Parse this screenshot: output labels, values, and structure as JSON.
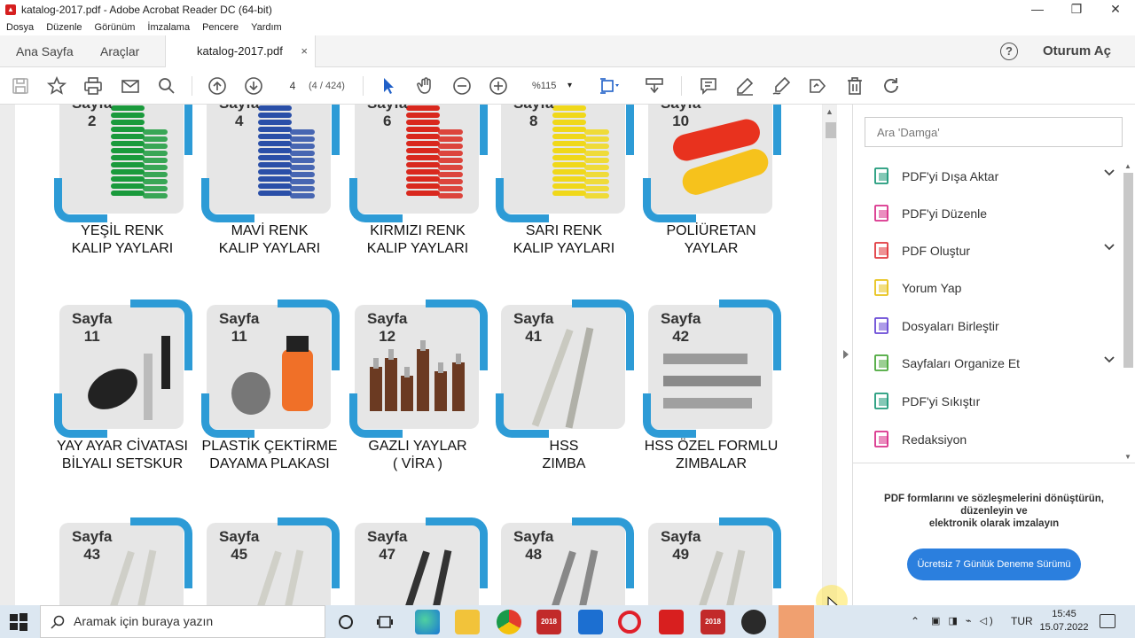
{
  "window": {
    "title": "katalog-2017.pdf - Adobe Acrobat Reader DC (64-bit)",
    "controls": {
      "minimize": "—",
      "maximize": "❐",
      "close": "✕"
    }
  },
  "menu": [
    "Dosya",
    "Düzenle",
    "Görünüm",
    "İmzalama",
    "Pencere",
    "Yardım"
  ],
  "tabs": {
    "home": "Ana Sayfa",
    "tools": "Araçlar",
    "document": "katalog-2017.pdf",
    "close": "×"
  },
  "help_label": "?",
  "signin": "Oturum Aç",
  "toolbar": {
    "page_current": "4",
    "page_count": "(4 / 424)",
    "zoom": "%115"
  },
  "catalog": {
    "row1": [
      {
        "page_label": "Sayfa",
        "page": "2",
        "line1": "YEŞİL RENK",
        "line2": "KALIP YAYLARI",
        "color": "#1a9a3c"
      },
      {
        "page_label": "Sayfa",
        "page": "4",
        "line1": "MAVİ RENK",
        "line2": "KALIP YAYLARI",
        "color": "#2a4fa8"
      },
      {
        "page_label": "Sayfa",
        "page": "6",
        "line1": "KIRMIZI RENK",
        "line2": "KALIP YAYLARI",
        "color": "#d9281e"
      },
      {
        "page_label": "Sayfa",
        "page": "8",
        "line1": "SARI RENK",
        "line2": "KALIP YAYLARI",
        "color": "#f0d81a"
      },
      {
        "page_label": "Sayfa",
        "page": "10",
        "line1": "POLİÜRETAN",
        "line2": "YAYLAR",
        "color": "#e8321e"
      }
    ],
    "row2": [
      {
        "page_label": "Sayfa",
        "page": "11",
        "line1": "YAY AYAR CİVATASI",
        "line2": "BİLYALI SETSKUR",
        "color": "#222222"
      },
      {
        "page_label": "Sayfa",
        "page": "11",
        "line1": "PLASTİK ÇEKTİRME",
        "line2": "DAYAMA PLAKASI",
        "color": "#f07028"
      },
      {
        "page_label": "Sayfa",
        "page": "12",
        "line1": "GAZLI YAYLAR",
        "line2": "( VİRA )",
        "color": "#6b3a22"
      },
      {
        "page_label": "Sayfa",
        "page": "41",
        "line1": "HSS",
        "line2": "ZIMBA",
        "color": "#b8b8b0"
      },
      {
        "page_label": "Sayfa",
        "page": "42",
        "line1": "HSS ÖZEL FORMLU",
        "line2": "ZIMBALAR",
        "color": "#8a8a8a"
      }
    ],
    "row3": [
      {
        "page_label": "Sayfa",
        "page": "43"
      },
      {
        "page_label": "Sayfa",
        "page": "45"
      },
      {
        "page_label": "Sayfa",
        "page": "47"
      },
      {
        "page_label": "Sayfa",
        "page": "48"
      },
      {
        "page_label": "Sayfa",
        "page": "49"
      }
    ]
  },
  "right_panel": {
    "search_placeholder": "Ara 'Damga'",
    "items": [
      {
        "label": "PDF'yi Dışa Aktar",
        "icon": "export-pdf-icon",
        "color": "#1f9a7a",
        "expandable": true
      },
      {
        "label": "PDF'yi Düzenle",
        "icon": "edit-pdf-icon",
        "color": "#d9318b",
        "expandable": false
      },
      {
        "label": "PDF Oluştur",
        "icon": "create-pdf-icon",
        "color": "#e0393e",
        "expandable": true
      },
      {
        "label": "Yorum Yap",
        "icon": "comment-icon",
        "color": "#e8c21a",
        "expandable": false
      },
      {
        "label": "Dosyaları Birleştir",
        "icon": "combine-files-icon",
        "color": "#6a4ad6",
        "expandable": false
      },
      {
        "label": "Sayfaları Organize Et",
        "icon": "organize-pages-icon",
        "color": "#4aa83a",
        "expandable": true
      },
      {
        "label": "PDF'yi Sıkıştır",
        "icon": "compress-pdf-icon",
        "color": "#1f9a7a",
        "expandable": false
      },
      {
        "label": "Redaksiyon",
        "icon": "redact-icon",
        "color": "#d9318b",
        "expandable": false
      }
    ],
    "promo_line1": "PDF formlarını ve sözleşmelerini dönüştürün,",
    "promo_line2": "düzenleyin ve",
    "promo_line3": "elektronik olarak imzalayın",
    "promo_button": "Ücretsiz 7 Günlük Deneme Sürümü"
  },
  "taskbar": {
    "search_placeholder": "Aramak için buraya yazın",
    "language": "TUR",
    "time": "15:45",
    "date": "15.07.2022",
    "sw_badge": "2018"
  }
}
